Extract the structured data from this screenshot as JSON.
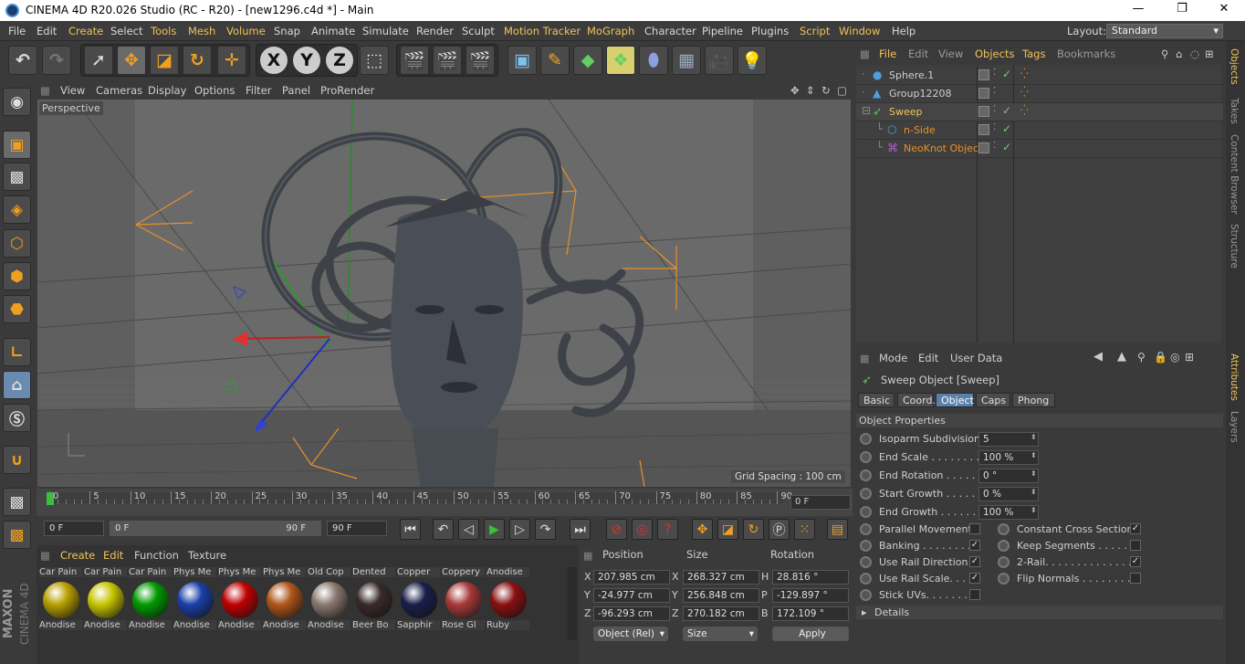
{
  "window": {
    "title": "CINEMA 4D R20.026 Studio (RC - R20) - [new1296.c4d *] - Main",
    "controls": [
      "—",
      "❐",
      "✕"
    ]
  },
  "menubar": {
    "items": [
      "File",
      "Edit",
      "Create",
      "Select",
      "Tools",
      "Mesh",
      "Volume",
      "Snap",
      "Animate",
      "Simulate",
      "Render",
      "Sculpt",
      "Motion Tracker",
      "MoGraph",
      "Character",
      "Pipeline",
      "Plugins",
      "Script",
      "Window",
      "Help"
    ],
    "layout_label": "Layout:",
    "layout_value": "Standard"
  },
  "toolbar": {
    "axis_x": "X",
    "axis_y": "Y",
    "axis_z": "Z"
  },
  "viewport": {
    "menu": [
      "View",
      "Cameras",
      "Display",
      "Options",
      "Filter",
      "Panel",
      "ProRender"
    ],
    "camera_label": "Perspective",
    "grid_spacing": "Grid Spacing : 100 cm"
  },
  "timeline": {
    "ticks": [
      "0",
      "5",
      "10",
      "15",
      "20",
      "25",
      "30",
      "35",
      "40",
      "45",
      "50",
      "55",
      "60",
      "65",
      "70",
      "75",
      "80",
      "85",
      "90"
    ],
    "current_frame": "0 F"
  },
  "transport": {
    "start": "0 F",
    "range_start": "0 F",
    "range_end": "90 F",
    "end": "90 F"
  },
  "materials": {
    "menu": [
      "Create",
      "Edit",
      "Function",
      "Texture"
    ],
    "top_row": [
      "Car Pain",
      "Car Pain",
      "Car Pain",
      "Phys Me",
      "Phys Me",
      "Phys Me",
      "Old Cop",
      "Dented",
      "Copper",
      "Coppery",
      "Anodise"
    ],
    "bottom_row": [
      "Anodise",
      "Anodise",
      "Anodise",
      "Anodise",
      "Anodise",
      "Anodise",
      "Anodise",
      "Beer Bo",
      "Sapphir",
      "Rose Gl",
      "Ruby"
    ],
    "colors": [
      "#b8a000",
      "#c7c400",
      "#009a00",
      "#1a3fa8",
      "#c00000",
      "#b0561a",
      "#8a7a70",
      "#3a2a2a",
      "#1a1f4a",
      "#a83a3a",
      "#8a1010"
    ],
    "brand_line1": "MAXON",
    "brand_line2": "CINEMA 4D"
  },
  "coords": {
    "headers": [
      "Position",
      "Size",
      "Rotation"
    ],
    "rows": [
      {
        "axis": "X",
        "pos": "207.985 cm",
        "size_axis": "X",
        "size": "268.327 cm",
        "rot_axis": "H",
        "rot": "28.816 °"
      },
      {
        "axis": "Y",
        "pos": "-24.977 cm",
        "size_axis": "Y",
        "size": "256.848 cm",
        "rot_axis": "P",
        "rot": "-129.897 °"
      },
      {
        "axis": "Z",
        "pos": "-96.293 cm",
        "size_axis": "Z",
        "size": "270.182 cm",
        "rot_axis": "B",
        "rot": "172.109 °"
      }
    ],
    "mode_select": "Object (Rel)",
    "size_select": "Size",
    "apply_label": "Apply"
  },
  "objects": {
    "menu": [
      "File",
      "Edit",
      "View",
      "Objects",
      "Tags",
      "Bookmarks"
    ],
    "items": [
      {
        "name": "Sphere.1",
        "color": "#cfcfcf",
        "indent": 0
      },
      {
        "name": "Group12208",
        "color": "#cfcfcf",
        "indent": 0
      },
      {
        "name": "Sweep",
        "color": "#f0c35a",
        "indent": 0
      },
      {
        "name": "n-Side",
        "color": "#e8902a",
        "indent": 1
      },
      {
        "name": "NeoKnot Object",
        "color": "#e8902a",
        "indent": 1
      }
    ]
  },
  "attributes": {
    "menu": [
      "Mode",
      "Edit",
      "User Data"
    ],
    "object_title": "Sweep Object [Sweep]",
    "tabs": [
      "Basic",
      "Coord.",
      "Object",
      "Caps",
      "Phong"
    ],
    "section": "Object Properties",
    "fields": [
      {
        "label": "Isoparm Subdivision",
        "value": "5"
      },
      {
        "label": "End Scale . . . . . . . . . .",
        "value": "100 %"
      },
      {
        "label": "End Rotation . . . . . .",
        "value": "0 °"
      },
      {
        "label": "Start Growth . . . . . .",
        "value": "0 %"
      },
      {
        "label": "End Growth . . . . . . .",
        "value": "100 %"
      }
    ],
    "checks_left": [
      {
        "label": "Parallel Movement",
        "checked": ""
      },
      {
        "label": "Banking . . . . . . . . .",
        "checked": "✓"
      },
      {
        "label": "Use Rail Direction",
        "checked": "✓"
      },
      {
        "label": "Use Rail Scale. . . .",
        "checked": "✓"
      },
      {
        "label": "Stick UVs. . . . . . . .",
        "checked": ""
      }
    ],
    "checks_right": [
      {
        "label": "Constant Cross Section",
        "checked": "✓"
      },
      {
        "label": "Keep Segments . . . . . .",
        "checked": ""
      },
      {
        "label": "2-Rail. . . . . . . . . . . . . . .",
        "checked": "✓"
      },
      {
        "label": "Flip Normals . . . . . . . . .",
        "checked": ""
      }
    ],
    "details": "Details"
  },
  "sidetabs": {
    "top": [
      "Objects",
      "Takes",
      "Content Browser",
      "Structure"
    ],
    "bottom": [
      "Attributes",
      "Layers"
    ]
  }
}
